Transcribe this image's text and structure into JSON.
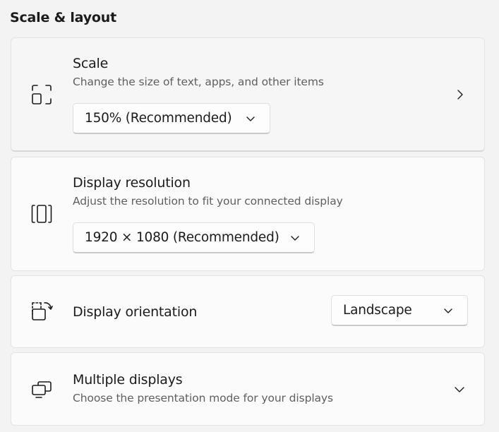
{
  "section": {
    "title": "Scale & layout"
  },
  "scale": {
    "title": "Scale",
    "subtitle": "Change the size of text, apps, and other items",
    "dropdown_value": "150% (Recommended)",
    "icon": "scale-icon"
  },
  "resolution": {
    "title": "Display resolution",
    "subtitle": "Adjust the resolution to fit your connected display",
    "dropdown_value": "1920 × 1080 (Recommended)",
    "icon": "resolution-icon"
  },
  "orientation": {
    "title": "Display orientation",
    "dropdown_value": "Landscape",
    "icon": "orientation-icon"
  },
  "multiple": {
    "title": "Multiple displays",
    "subtitle": "Choose the presentation mode for your displays",
    "icon": "multiple-displays-icon"
  }
}
